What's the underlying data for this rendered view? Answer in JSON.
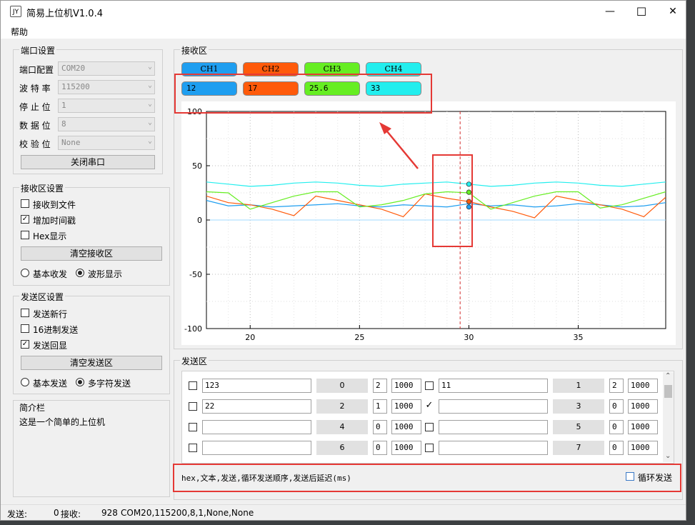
{
  "window": {
    "title": "简易上位机V1.0.4",
    "icon_text": "JY",
    "minimize": "—",
    "maximize": "☐",
    "close": "✕"
  },
  "menu": {
    "help": "帮助"
  },
  "port": {
    "title": "端口设置",
    "rows": [
      {
        "label": "端口配置",
        "value": "COM20"
      },
      {
        "label": "波 特 率",
        "value": "115200"
      },
      {
        "label": "停 止 位",
        "value": "1"
      },
      {
        "label": "数 据 位",
        "value": "8"
      },
      {
        "label": "校 验 位",
        "value": "None"
      }
    ],
    "close_btn": "关闭串口"
  },
  "recv_settings": {
    "title": "接收区设置",
    "to_file": "接收到文件",
    "timestamp": "增加时间戳",
    "hex": "Hex显示",
    "clear": "清空接收区",
    "basic": "基本收发",
    "wave": "波形显示"
  },
  "send_settings": {
    "title": "发送区设置",
    "newline": "发送新行",
    "hex16": "16进制发送",
    "echo": "发送回显",
    "clear": "清空发送区",
    "basic": "基本发送",
    "multi": "多字符发送"
  },
  "intro": {
    "title": "简介栏",
    "text": "这是一个简单的上位机"
  },
  "recv_area": {
    "title": "接收区",
    "channels": [
      {
        "name": "CH1",
        "value": "12",
        "color": "#1e9ef0"
      },
      {
        "name": "CH2",
        "value": "17",
        "color": "#ff5a0a"
      },
      {
        "name": "CH3",
        "value": "25.6",
        "color": "#66ee22"
      },
      {
        "name": "CH4",
        "value": "33",
        "color": "#22eeee"
      }
    ]
  },
  "chart_data": {
    "type": "line",
    "ylim": [
      -100,
      100
    ],
    "xlim": [
      18,
      39
    ],
    "yticks": [
      "100",
      "50",
      "0",
      "-50",
      "-100"
    ],
    "xticks": [
      "20",
      "25",
      "30",
      "35"
    ],
    "cursor_x": 29.6,
    "grid": true,
    "series": [
      {
        "color": "#1e9ef0",
        "x": [
          18,
          19,
          20,
          21,
          22,
          23,
          24,
          25,
          26,
          27,
          28,
          29,
          30,
          31,
          32,
          33,
          34,
          35,
          36,
          37,
          38,
          39
        ],
        "y": [
          18,
          13,
          14,
          12,
          13,
          14,
          15,
          13,
          12,
          14,
          13,
          12,
          15,
          13,
          14,
          12,
          13,
          15,
          14,
          12,
          13,
          16
        ]
      },
      {
        "color": "#ff5a0a",
        "x": [
          18,
          19,
          20,
          21,
          22,
          23,
          24,
          25,
          26,
          27,
          28,
          29,
          30,
          31,
          32,
          33,
          34,
          35,
          36,
          37,
          38,
          39
        ],
        "y": [
          22,
          16,
          14,
          10,
          4,
          22,
          18,
          14,
          10,
          3,
          24,
          20,
          17,
          12,
          8,
          2,
          22,
          18,
          14,
          10,
          3,
          21
        ]
      },
      {
        "color": "#66ee22",
        "x": [
          18,
          19,
          20,
          21,
          22,
          23,
          24,
          25,
          26,
          27,
          28,
          29,
          30,
          31,
          32,
          33,
          34,
          35,
          36,
          37,
          38,
          39
        ],
        "y": [
          26,
          25,
          10,
          16,
          22,
          26,
          26,
          12,
          14,
          18,
          24,
          26,
          25,
          10,
          16,
          22,
          26,
          26,
          11,
          14,
          20,
          26
        ]
      },
      {
        "color": "#22eeee",
        "x": [
          18,
          19,
          20,
          21,
          22,
          23,
          24,
          25,
          26,
          27,
          28,
          29,
          30,
          31,
          32,
          33,
          34,
          35,
          36,
          37,
          38,
          39
        ],
        "y": [
          35,
          33,
          31,
          32,
          34,
          35,
          34,
          32,
          31,
          33,
          34,
          35,
          33,
          31,
          32,
          34,
          35,
          34,
          32,
          31,
          33,
          35
        ]
      }
    ],
    "markers": [
      {
        "x": 30,
        "y": 33,
        "color": "#22eeee"
      },
      {
        "x": 30,
        "y": 25.6,
        "color": "#66ee22"
      },
      {
        "x": 30,
        "y": 17,
        "color": "#ff5a0a"
      },
      {
        "x": 30,
        "y": 12,
        "color": "#1e9ef0"
      }
    ]
  },
  "send_area": {
    "title": "发送区",
    "rows": [
      {
        "l_checked": false,
        "l_text": "123",
        "l_btn": "0",
        "l_order": "2",
        "l_delay": "1000",
        "r_checked": false,
        "r_text": "11",
        "r_btn": "1",
        "r_order": "2",
        "r_delay": "1000"
      },
      {
        "l_checked": false,
        "l_text": "22",
        "l_btn": "2",
        "l_order": "1",
        "l_delay": "1000",
        "r_checked": true,
        "r_text": "",
        "r_btn": "3",
        "r_order": "0",
        "r_delay": "1000"
      },
      {
        "l_checked": false,
        "l_text": "",
        "l_btn": "4",
        "l_order": "0",
        "l_delay": "1000",
        "r_checked": false,
        "r_text": "",
        "r_btn": "5",
        "r_order": "0",
        "r_delay": "1000"
      },
      {
        "l_checked": false,
        "l_text": "",
        "l_btn": "6",
        "l_order": "0",
        "l_delay": "1000",
        "r_checked": false,
        "r_text": "",
        "r_btn": "7",
        "r_order": "0",
        "r_delay": "1000"
      }
    ],
    "hint": "hex,文本,发送,循环发送顺序,发送后延迟(ms)",
    "loop": "循环发送"
  },
  "status": {
    "send_label": "发送:",
    "send_count": "0",
    "recv_label": "接收:",
    "recv_count": "928",
    "port_info": "COM20,115200,8,1,None,None"
  }
}
